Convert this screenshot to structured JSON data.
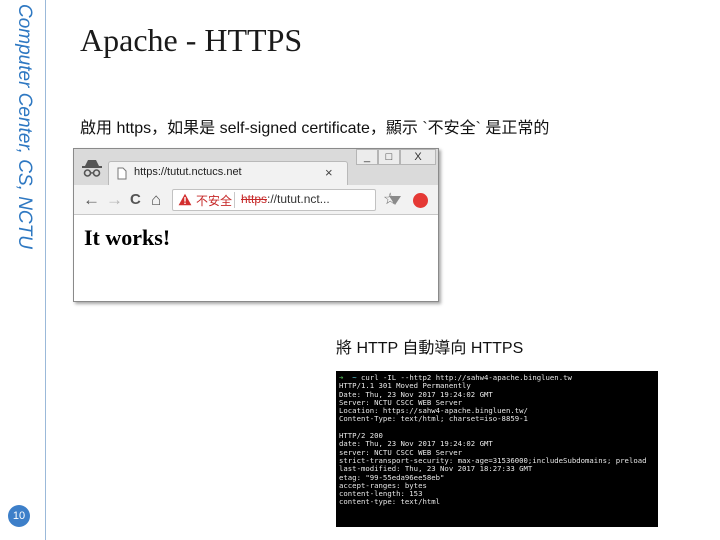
{
  "sidebar": {
    "vertical_text": "Computer Center, CS, NCTU",
    "page_number": "10"
  },
  "slide": {
    "title": "Apache - HTTPS",
    "description": "啟用 https，如果是 self-signed certificate，顯示 `不安全` 是正常的",
    "caption": "將 HTTP 自動導向 HTTPS"
  },
  "browser": {
    "tab_title": "https://tutut.nctucs.net",
    "tab_close": "×",
    "window_buttons": [
      "_",
      "□",
      "X"
    ],
    "nav": {
      "back": "←",
      "forward": "→",
      "reload": "C",
      "home": "⌂"
    },
    "security_label": "不安全",
    "url_scheme": "https",
    "url_rest": "://tutut.nct...",
    "star": "☆",
    "page_heading": "It works!"
  },
  "terminal": {
    "prompt_arrow": "➜",
    "prompt_dir": "~",
    "command": "curl -IL --http2 http://sahw4-apache.bingluen.tw",
    "lines": [
      "HTTP/1.1 301 Moved Permanently",
      "Date: Thu, 23 Nov 2017 19:24:02 GMT",
      "Server: NCTU CSCC WEB Server",
      "Location: https://sahw4-apache.bingluen.tw/",
      "Content-Type: text/html; charset=iso-8859-1",
      "",
      "HTTP/2 200",
      "date: Thu, 23 Nov 2017 19:24:02 GMT",
      "server: NCTU CSCC WEB Server",
      "strict-transport-security: max-age=31536000;includeSubdomains; preload",
      "last-modified: Thu, 23 Nov 2017 18:27:33 GMT",
      "etag: \"99-55eda96ee58eb\"",
      "accept-ranges: bytes",
      "content-length: 153",
      "content-type: text/html"
    ]
  }
}
